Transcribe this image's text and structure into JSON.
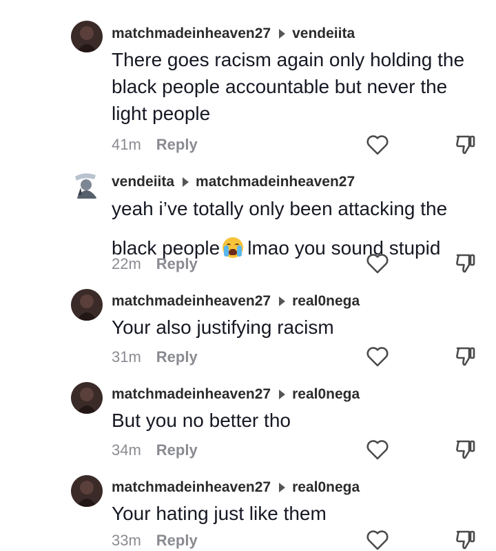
{
  "comments": [
    {
      "author": "matchmadeinheaven27",
      "reply_to": "vendeiita",
      "lines": [
        "There goes racism again only holding the",
        "black people accountable but never the",
        "light people"
      ],
      "time": "41m",
      "reply_label": "Reply"
    },
    {
      "author": "vendeiita",
      "reply_to": "matchmadeinheaven27",
      "lines": [
        "yeah i’ve totally only been attacking the",
        "black people",
        "lmao you sound stupid"
      ],
      "time": "22m",
      "reply_label": "Reply"
    },
    {
      "author": "matchmadeinheaven27",
      "reply_to": "real0nega",
      "lines": [
        "Your also justifying racism"
      ],
      "time": "31m",
      "reply_label": "Reply"
    },
    {
      "author": "matchmadeinheaven27",
      "reply_to": "real0nega",
      "lines": [
        "But you no better tho"
      ],
      "time": "34m",
      "reply_label": "Reply"
    },
    {
      "author": "matchmadeinheaven27",
      "reply_to": "real0nega",
      "lines": [
        "Your hating just like them"
      ],
      "time": "33m",
      "reply_label": "Reply"
    }
  ],
  "icons": {
    "reply_arrow": "caret-right-icon",
    "emoji": "loudly-crying-face-icon",
    "like": "heart-outline-icon",
    "dislike": "thumbs-down-outline-icon"
  },
  "colors": {
    "text": "#161823",
    "username": "#2b2b2b",
    "meta": "#8a8b91",
    "icon_stroke": "#4a4a4a"
  }
}
